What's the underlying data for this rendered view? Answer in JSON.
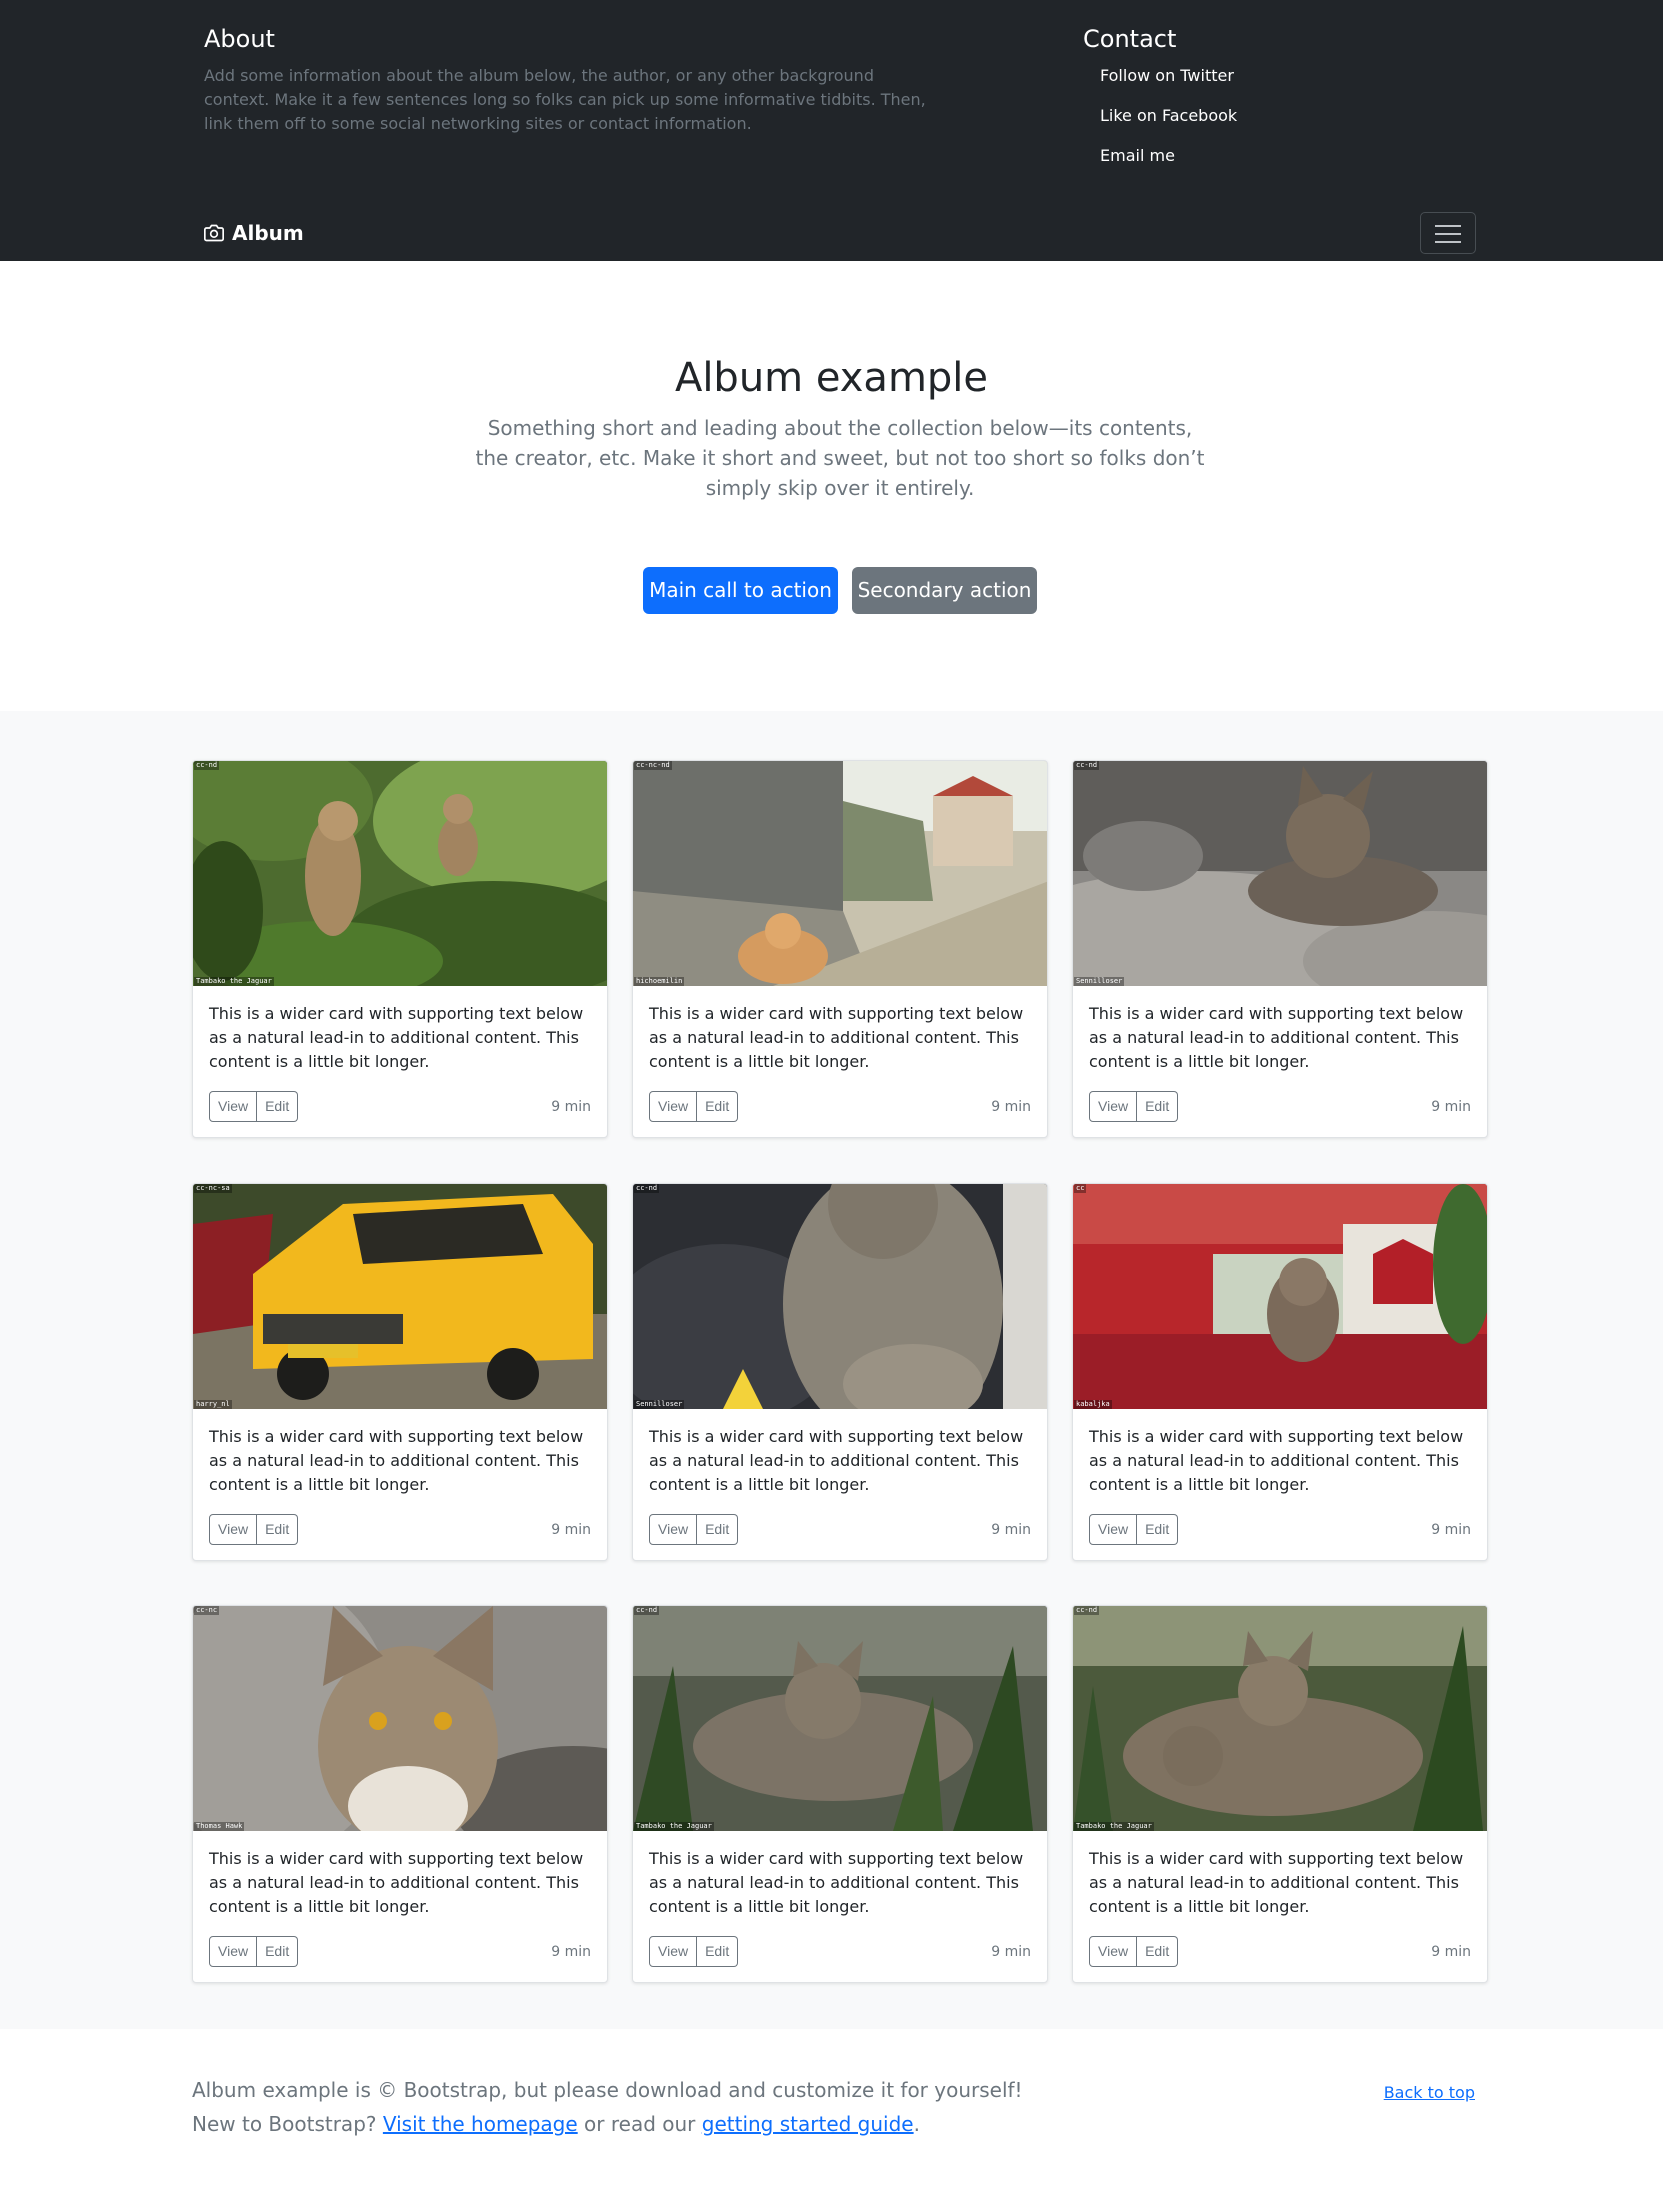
{
  "header": {
    "about_title": "About",
    "about_text": "Add some information about the album below, the author, or any other background context. Make it a few sentences long so folks can pick up some informative tidbits. Then, link them off to some social networking sites or contact information.",
    "contact_title": "Contact",
    "contact_links": [
      "Follow on Twitter",
      "Like on Facebook",
      "Email me"
    ],
    "brand": "Album"
  },
  "hero": {
    "title": "Album example",
    "lead": "Something short and leading about the collection below—its contents, the creator, etc. Make it short and sweet, but not too short so folks don’t simply skip over it entirely.",
    "primary_button": "Main call to action",
    "secondary_button": "Secondary action"
  },
  "cards": [
    {
      "license": "cc-nd",
      "credit": "Tambako the Jaguar",
      "text": "This is a wider card with supporting text below as a natural lead-in to additional content. This content is a little bit longer.",
      "view": "View",
      "edit": "Edit",
      "time": "9 min"
    },
    {
      "license": "cc-nc-nd",
      "credit": "hichoemilin",
      "text": "This is a wider card with supporting text below as a natural lead-in to additional content. This content is a little bit longer.",
      "view": "View",
      "edit": "Edit",
      "time": "9 min"
    },
    {
      "license": "cc-nd",
      "credit": "Sennilloser",
      "text": "This is a wider card with supporting text below as a natural lead-in to additional content. This content is a little bit longer.",
      "view": "View",
      "edit": "Edit",
      "time": "9 min"
    },
    {
      "license": "cc-nc-sa",
      "credit": "harry_nl",
      "text": "This is a wider card with supporting text below as a natural lead-in to additional content. This content is a little bit longer.",
      "view": "View",
      "edit": "Edit",
      "time": "9 min"
    },
    {
      "license": "cc-nd",
      "credit": "Sennilloser",
      "text": "This is a wider card with supporting text below as a natural lead-in to additional content. This content is a little bit longer.",
      "view": "View",
      "edit": "Edit",
      "time": "9 min"
    },
    {
      "license": "cc",
      "credit": "kabaljka",
      "text": "This is a wider card with supporting text below as a natural lead-in to additional content. This content is a little bit longer.",
      "view": "View",
      "edit": "Edit",
      "time": "9 min"
    },
    {
      "license": "cc-nc",
      "credit": "Thomas Hawk",
      "text": "This is a wider card with supporting text below as a natural lead-in to additional content. This content is a little bit longer.",
      "view": "View",
      "edit": "Edit",
      "time": "9 min"
    },
    {
      "license": "cc-nd",
      "credit": "Tambako the Jaguar",
      "text": "This is a wider card with supporting text below as a natural lead-in to additional content. This content is a little bit longer.",
      "view": "View",
      "edit": "Edit",
      "time": "9 min"
    },
    {
      "license": "cc-nd",
      "credit": "Tambako the Jaguar",
      "text": "This is a wider card with supporting text below as a natural lead-in to additional content. This content is a little bit longer.",
      "view": "View",
      "edit": "Edit",
      "time": "9 min"
    }
  ],
  "footer": {
    "line1": "Album example is © Bootstrap, but please download and customize it for yourself!",
    "line2_prefix": "New to Bootstrap?",
    "homepage_link": "Visit the homepage",
    "line2_middle": "or read our",
    "guide_link": "getting started guide",
    "line2_suffix": ".",
    "back_to_top": "Back to top"
  },
  "colors": {
    "dark": "#212529",
    "primary": "#0d6efd",
    "secondary": "#6c757d",
    "album_bg": "#f8f9fa"
  }
}
